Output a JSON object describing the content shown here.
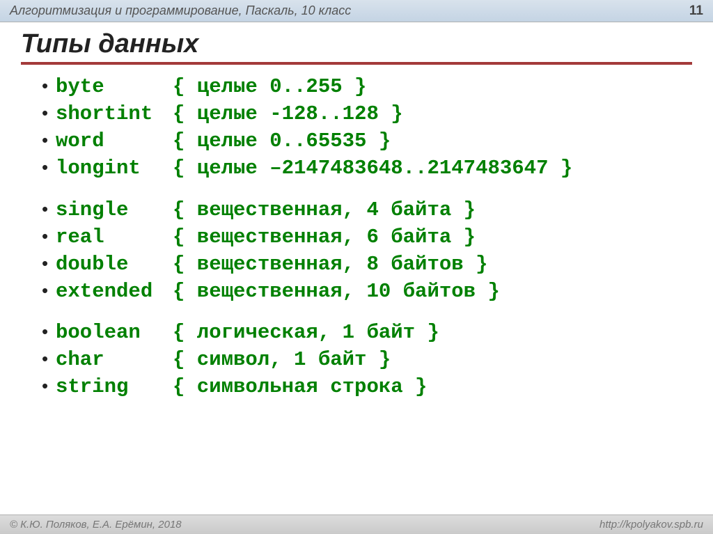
{
  "header": {
    "title": "Алгоритмизация и программирование, Паскаль, 10 класс",
    "page": "11"
  },
  "slide": {
    "title": "Типы данных"
  },
  "groups": [
    [
      {
        "name": "byte",
        "desc": "{ целые 0..255 }"
      },
      {
        "name": "shortint",
        "desc": "{ целые -128..128 }"
      },
      {
        "name": "word",
        "desc": "{ целые 0..65535 }"
      },
      {
        "name": "longint",
        "desc": "{ целые –2147483648..2147483647 }"
      }
    ],
    [
      {
        "name": "single",
        "desc": "{ вещественная, 4 байта }"
      },
      {
        "name": "real",
        "desc": "{ вещественная, 6 байта }"
      },
      {
        "name": "double",
        "desc": "{ вещественная, 8 байтов }"
      },
      {
        "name": "extended",
        "desc": "{ вещественная, 10 байтов }"
      }
    ],
    [
      {
        "name": "boolean",
        "desc": "{ логическая, 1 байт }"
      },
      {
        "name": "char",
        "desc": "{ символ, 1 байт }"
      },
      {
        "name": "string",
        "desc": "{ символьная строка }"
      }
    ]
  ],
  "footer": {
    "left": "© К.Ю. Поляков, Е.А. Ерёмин, 2018",
    "right": "http://kpolyakov.spb.ru"
  }
}
